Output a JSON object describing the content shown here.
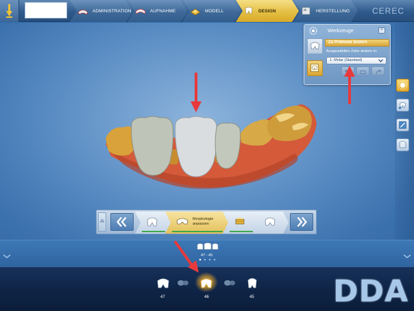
{
  "topbar": {
    "phases": [
      {
        "label": "ADMINISTRATION",
        "icon": "patient-file-icon",
        "active": false
      },
      {
        "label": "AUFNAHME",
        "icon": "intraoral-scan-icon",
        "active": false
      },
      {
        "label": "MODELL",
        "icon": "model-icon",
        "active": false
      },
      {
        "label": "DESIGN",
        "icon": "tooth-design-icon",
        "active": true
      },
      {
        "label": "HERSTELLUNG",
        "icon": "milling-unit-icon",
        "active": false
      }
    ],
    "brand": "CEREC"
  },
  "tools_panel": {
    "title": "Werkzeuge",
    "active_tool": "Zu Prämolar ändern",
    "sublabel": "Ausgewählten Zahn ändern in:",
    "select_value": "1. Molar (Standard)"
  },
  "step_bar": {
    "active_step_line1": "Morphologie",
    "active_step_line2": "anpassen"
  },
  "restoration_strip": {
    "label": "47 - 45"
  },
  "tooth_selector": {
    "teeth": [
      {
        "number": "47",
        "selected": false
      },
      {
        "number": "46",
        "selected": true
      },
      {
        "number": "45",
        "selected": false
      }
    ]
  },
  "watermark": "DDA",
  "colors": {
    "accent_gold": "#e4bf44",
    "pointer_red": "#e8393c",
    "completed_green": "#3fa84a"
  }
}
